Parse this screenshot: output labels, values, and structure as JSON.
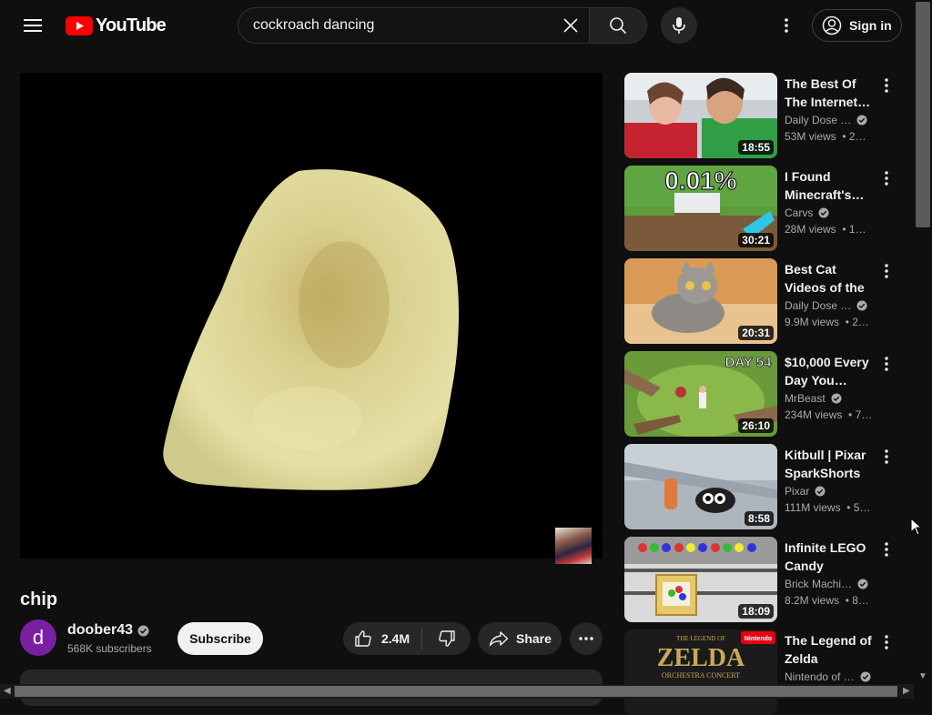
{
  "header": {
    "logo_text": "YouTube",
    "search_value": "cockroach dancing",
    "signin_label": "Sign in"
  },
  "video": {
    "title": "chip",
    "channel": "doober43",
    "avatar_letter": "d",
    "subscribers": "568K subscribers",
    "subscribe_label": "Subscribe",
    "likes": "2.4M",
    "share_label": "Share"
  },
  "recommendations": [
    {
      "title": "The Best Of The Internet…",
      "channel": "Daily Dose …",
      "verified": true,
      "views": "53M views",
      "age": "• 2…",
      "duration": "18:55"
    },
    {
      "title": "I Found Minecraft's…",
      "channel": "Carvs",
      "verified": true,
      "views": "28M views",
      "age": "• 1…",
      "duration": "30:21"
    },
    {
      "title": "Best Cat Videos of the Decade",
      "channel": "Daily Dose …",
      "verified": true,
      "views": "9.9M views",
      "age": "• 2…",
      "duration": "20:31"
    },
    {
      "title": "$10,000 Every Day You…",
      "channel": "MrBeast",
      "verified": true,
      "views": "234M views",
      "age": "• 7…",
      "duration": "26:10"
    },
    {
      "title": "Kitbull | Pixar SparkShorts",
      "channel": "Pixar",
      "verified": true,
      "views": "111M views",
      "age": "• 5…",
      "duration": "8:58"
    },
    {
      "title": "Infinite LEGO Candy Factory…",
      "channel": "Brick Machi…",
      "verified": true,
      "views": "8.2M views",
      "age": "• 8…",
      "duration": "18:09"
    },
    {
      "title": "The Legend of Zelda Orchest…",
      "channel": "Nintendo of …",
      "verified": true,
      "views": "",
      "age": "",
      "duration": ""
    }
  ],
  "thumbnail_text": {
    "minecraft": "0.01%",
    "mrbeast": "DAY 54",
    "zelda_brand": "Nintendo",
    "zelda_logo": "ZELDA",
    "zelda_top": "THE LEGEND OF",
    "zelda_sub": "ORCHESTRA CONCERT"
  },
  "colors": {
    "brand_red": "#ff0000",
    "background": "#0f0f0f",
    "avatar": "#7b1fa2"
  }
}
